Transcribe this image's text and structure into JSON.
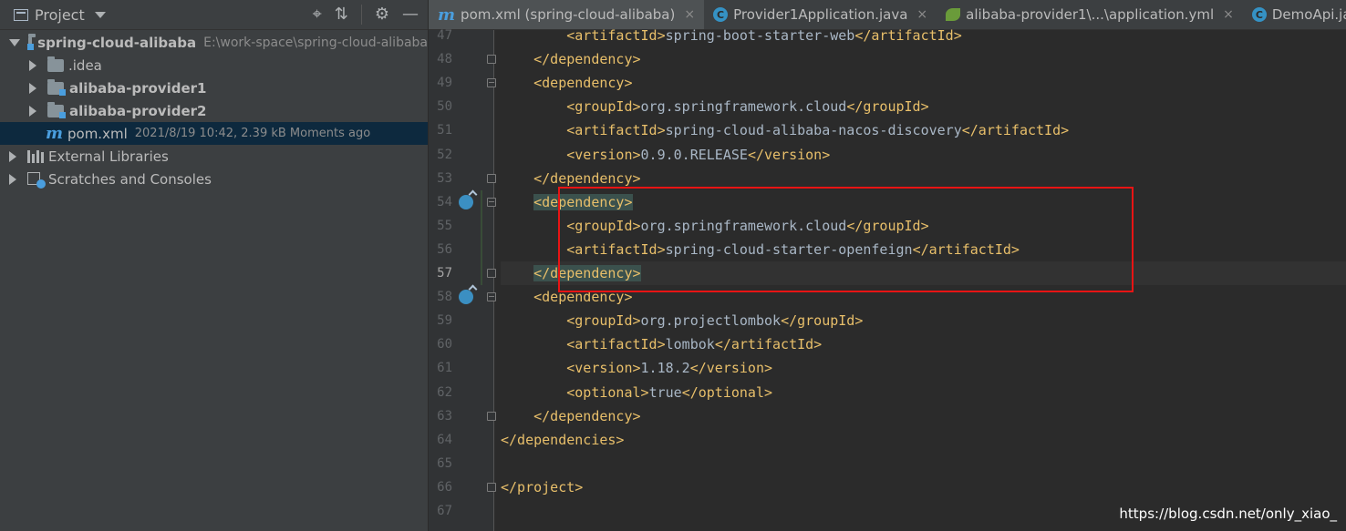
{
  "project_panel": {
    "title": "Project",
    "tools": {
      "locate": "⌖",
      "collapse": "⇅",
      "settings": "⚙",
      "hide": "—"
    },
    "tree": [
      {
        "label": "spring-cloud-alibaba",
        "hint": "E:\\work-space\\spring-cloud-alibaba"
      },
      {
        "label": ".idea"
      },
      {
        "label": "alibaba-provider1"
      },
      {
        "label": "alibaba-provider2"
      },
      {
        "label": "pom.xml",
        "hint": "2021/8/19 10:42, 2.39 kB Moments ago"
      },
      {
        "label": "External Libraries"
      },
      {
        "label": "Scratches and Consoles"
      }
    ]
  },
  "tabs": [
    {
      "label": "pom.xml (spring-cloud-alibaba)",
      "close": "×"
    },
    {
      "label": "Provider1Application.java",
      "close": "×"
    },
    {
      "label": "alibaba-provider1\\...\\application.yml",
      "close": "×"
    },
    {
      "label": "DemoApi.java"
    }
  ],
  "editor": {
    "lines": [
      {
        "num": "47",
        "code": "        <artifactId>spring-boot-starter-web</artifactId>"
      },
      {
        "num": "48",
        "code": "    </dependency>"
      },
      {
        "num": "49",
        "code": "    <dependency>"
      },
      {
        "num": "50",
        "code": "        <groupId>org.springframework.cloud</groupId>"
      },
      {
        "num": "51",
        "code": "        <artifactId>spring-cloud-alibaba-nacos-discovery</artifactId>"
      },
      {
        "num": "52",
        "code": "        <version>0.9.0.RELEASE</version>"
      },
      {
        "num": "53",
        "code": "    </dependency>"
      },
      {
        "num": "54",
        "code": "    <dependency>"
      },
      {
        "num": "55",
        "code": "        <groupId>org.springframework.cloud</groupId>"
      },
      {
        "num": "56",
        "code": "        <artifactId>spring-cloud-starter-openfeign</artifactId>"
      },
      {
        "num": "57",
        "code": "    </dependency>"
      },
      {
        "num": "58",
        "code": "    <dependency>"
      },
      {
        "num": "59",
        "code": "        <groupId>org.projectlombok</groupId>"
      },
      {
        "num": "60",
        "code": "        <artifactId>lombok</artifactId>"
      },
      {
        "num": "61",
        "code": "        <version>1.18.2</version>"
      },
      {
        "num": "62",
        "code": "        <optional>true</optional>"
      },
      {
        "num": "63",
        "code": "    </dependency>"
      },
      {
        "num": "64",
        "code": "</dependencies>"
      },
      {
        "num": "65",
        "code": ""
      },
      {
        "num": "66",
        "code": "</project>"
      },
      {
        "num": "67",
        "code": ""
      }
    ]
  },
  "watermark": "https://blog.csdn.net/only_xiao_",
  "colors": {
    "tag": "#e8bf6a",
    "text": "#a9b7c6",
    "highlight_box": "#e81414"
  }
}
